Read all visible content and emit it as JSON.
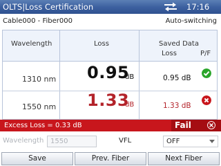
{
  "titlebar": {
    "title": "OLTS|Loss Certification",
    "time": "17:16",
    "sync_icon": "sync-arrows-icon"
  },
  "info": {
    "path": "Cable000 - Fiber000",
    "mode": "Auto-switching"
  },
  "table": {
    "headers": {
      "wavelength": "Wavelength",
      "loss": "Loss",
      "saved_data": "Saved Data",
      "saved_loss": "Loss",
      "pf": "P/F"
    },
    "rows": [
      {
        "wavelength": "1310 nm",
        "loss": "0.95",
        "unit": "dB",
        "saved": "0.95 dB",
        "status": "pass"
      },
      {
        "wavelength": "1550 nm",
        "loss": "1.33",
        "unit": "dB",
        "saved": "1.33 dB",
        "status": "fail"
      }
    ]
  },
  "status": {
    "excess": "Excess Loss = 0.33 dB",
    "result": "Fail"
  },
  "controls": {
    "wavelength_label": "Wavelength",
    "wavelength_value": "1550",
    "vfl_label": "VFL",
    "vfl_value": "OFF"
  },
  "buttons": {
    "save": "Save",
    "prev": "Prev. Fiber",
    "next": "Next Fiber"
  },
  "colors": {
    "titlebar": "#3d61a0",
    "fail": "#c8161c",
    "pass": "#2aa52a",
    "fail_text": "#b3232a"
  }
}
